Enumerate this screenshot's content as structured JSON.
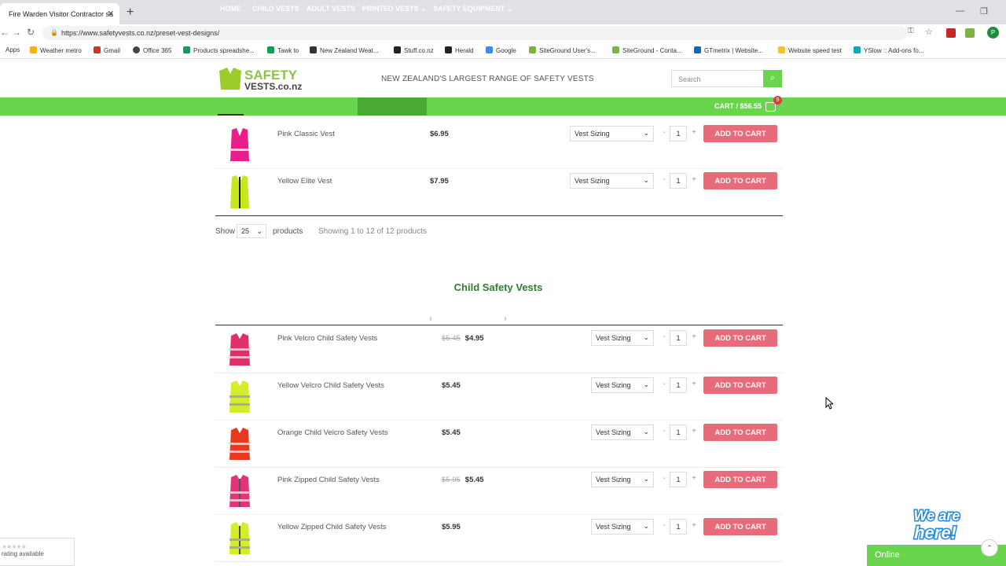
{
  "browser": {
    "tab_title": "Fire Warden Visitor Contractor sa",
    "tab_close": "✕",
    "new_tab": "+",
    "url": "https://www.safetyvests.co.nz/preset-vest-designs/",
    "avatar_letter": "P",
    "bookmarks": [
      {
        "label": "Apps",
        "color": "#4285f4"
      },
      {
        "label": "Weather metro",
        "color": "#f4b400"
      },
      {
        "label": "Gmail",
        "color": "#d93025"
      },
      {
        "label": "Office 365",
        "color": "#444444"
      },
      {
        "label": "Products spreadshe...",
        "color": "#0f9d58"
      },
      {
        "label": "Tawk to",
        "color": "#0f9d58"
      },
      {
        "label": "New Zealand Weat...",
        "color": "#333333"
      },
      {
        "label": "Stuff.co.nz",
        "color": "#222222"
      },
      {
        "label": "Herald",
        "color": "#222222"
      },
      {
        "label": "Google",
        "color": "#4285f4"
      },
      {
        "label": "SiteGround User's...",
        "color": "#7cb342"
      },
      {
        "label": "SiteGround - Conta...",
        "color": "#7cb342"
      },
      {
        "label": "GTmetrix | Website...",
        "color": "#1565c0"
      },
      {
        "label": "Website speed test",
        "color": "#fbc02d"
      },
      {
        "label": "YSlow :: Add-ons fo...",
        "color": "#00acc1"
      }
    ]
  },
  "header": {
    "tagline": "NEW ZEALAND'S LARGEST RANGE OF SAFETY VESTS",
    "search_placeholder": "Search",
    "nav": [
      "HOME",
      "CHILD VESTS",
      "ADULT VESTS",
      "PRINTED VESTS ⌄",
      "SAFETY EQUIPMENT ⌄"
    ],
    "cart_label": "CART / $56.55",
    "cart_count": "9"
  },
  "colors": {
    "brand_green": "#6bd44e",
    "add_to_cart": "#e86b79",
    "section_title": "#2e7d32"
  },
  "common": {
    "size_label": "Vest Sizing",
    "qty": "1",
    "minus": "-",
    "plus": "+",
    "add_to_cart": "ADD TO CART"
  },
  "preset_products": [
    {
      "name": "Pink Classic Vest",
      "price": "$6.95",
      "color": "#e91e8c"
    },
    {
      "name": "Yellow Elite Vest",
      "price": "$7.95",
      "color": "#c6e81e"
    }
  ],
  "pagination": {
    "show": "Show",
    "per_page": "25",
    "products": "products",
    "showing": "Showing 1 to 12 of 12 products"
  },
  "section_title": "Child Safety Vests",
  "child_products": [
    {
      "name": "Pink Velcro Child Safety Vests",
      "old_price": "$5.45",
      "price": "$4.95",
      "color": "#e0306b"
    },
    {
      "name": "Yellow Velcro Child Safety Vests",
      "old_price": "",
      "price": "$5.45",
      "color": "#d4ec2a"
    },
    {
      "name": "Orange Child Velcro Safety Vests",
      "old_price": "",
      "price": "$5.45",
      "color": "#e8381f"
    },
    {
      "name": "Pink Zipped Child Safety Vests",
      "old_price": "$5.95",
      "price": "$5.45",
      "color": "#e23478"
    },
    {
      "name": "Yellow Zipped Child Safety Vests",
      "old_price": "",
      "price": "$5.95",
      "color": "#d4ec2a"
    }
  ],
  "widgets": {
    "rating": "rating available",
    "we_are_here": "We are here!",
    "online": "Online"
  }
}
